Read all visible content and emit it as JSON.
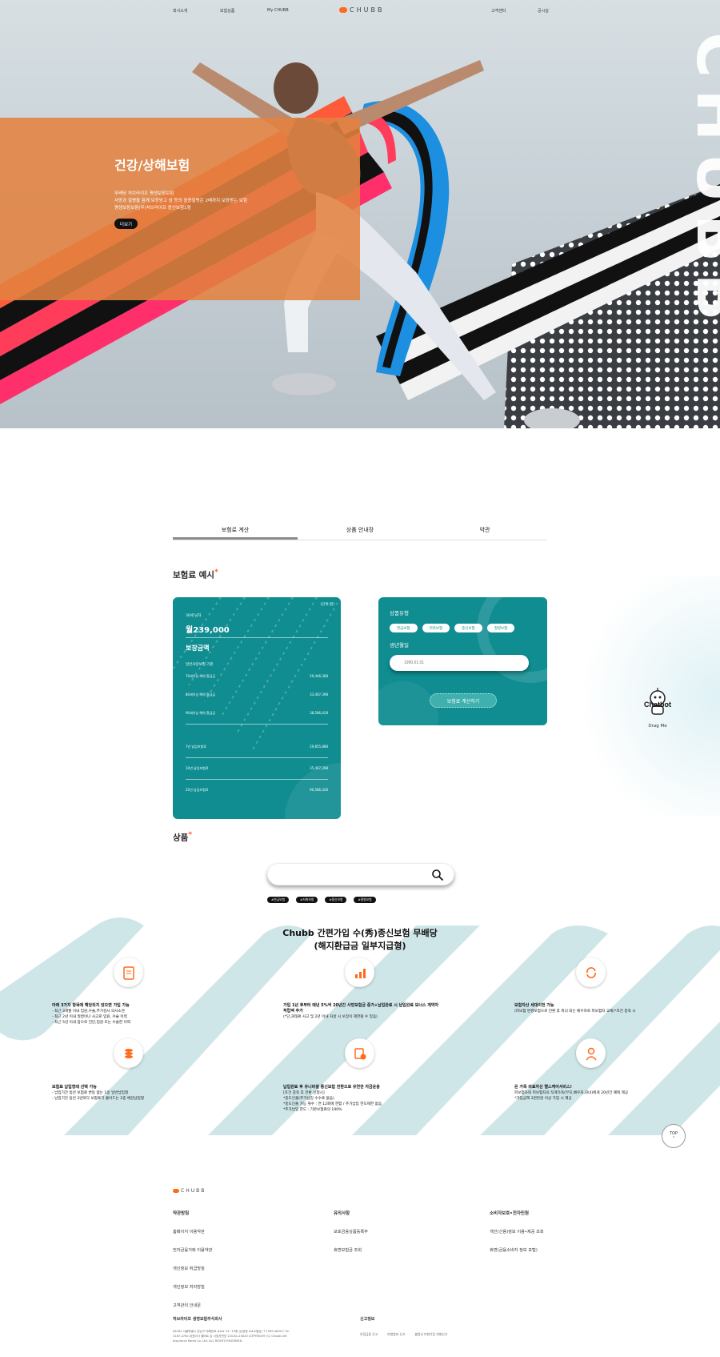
{
  "header": {
    "nav_left": [
      "회사소개",
      "보험상품",
      "My CHUBB"
    ],
    "logo_text": "CHUBB",
    "nav_right": [
      "고객센터",
      "공시실"
    ]
  },
  "hero": {
    "title": "건강/상해보험",
    "desc_lines": [
      "무배당 처브라이프 평생보장보험",
      "사망과 질병을 함께 보장받고 암 등의 중증질병은 2배까지 보장받는 보험",
      "평생보장보험(무)처브라이프 종신보험1형"
    ],
    "button": "더보기",
    "brand_vertical": "CHUBB"
  },
  "tabs": [
    "보험료 계산",
    "상품 안내장",
    "약관"
  ],
  "premium_section": {
    "title": "보험료 예시",
    "card": {
      "unit": "(단위:원)",
      "monthly_label": "30세 남자",
      "monthly_value": "월239,000",
      "coverage_title": "보장금액",
      "coverage_sub": "일반사망보험 기준",
      "rows_a": [
        {
          "label": "70세이상 해약 환급금",
          "value": "29,446,368"
        },
        {
          "label": "80세이상 해약 환급금",
          "value": "33,407,398"
        },
        {
          "label": "90세이상 해약 환급금",
          "value": "38,586,428"
        }
      ],
      "rows_b": [
        {
          "label": "7년 납입보험료",
          "value": "29,855,888"
        },
        {
          "label": "10년 납입보험료",
          "value": "35,407,398"
        },
        {
          "label": "20년 납입보험료",
          "value": "90,586,428"
        }
      ]
    },
    "form": {
      "product_type_label": "상품유형",
      "types": [
        "연금보험",
        "저축보험",
        "종신보험",
        "질병보험"
      ],
      "birth_label": "생년월일",
      "birth_placeholder": "1990.01.01",
      "submit": "보험료 계산하기"
    }
  },
  "chatbot": {
    "name": "Chatbot",
    "label": "Drag Me"
  },
  "products_section": {
    "title": "상품",
    "search_placeholder": "",
    "tags": [
      "#연금보험",
      "#저축보험",
      "#종신보험",
      "#질병보험"
    ]
  },
  "featured": {
    "title_line1": "Chubb 간편가입 수(秀)종신보험 무배당",
    "title_line2": "(해지환급금 일부지급형)",
    "items": [
      {
        "icon": "clipboard-icon",
        "title": "아래 3가지 항목에 해당되지 않으면 가입 가능",
        "lines": [
          "- 최근 3개월 이내 입원,수술,추가검사 의사소견",
          "- 최근 2년 이내 질병이나 사고로 입원, 수술 이력",
          "- 최근 5년 이내 암으로 진단,입원 또는 수술한 이력"
        ]
      },
      {
        "icon": "growth-chart-icon",
        "title": "가입 1년 후부터 매년 5%씩 20년간 사망보험금 증가+납입완료 시 납입완료 보너스 계약자 적립액 추가",
        "lines": [
          "(*단,과태료 사고 및 2년 이내 자살 시 보장이 제한될 수 있음)"
        ]
      },
      {
        "icon": "refresh-icon",
        "title": "보험자산 세대이전 가능",
        "lines": [
          "(피보험 변경보험으로 전환 후 피너 되는 배우자로 피보험자 교체)*조건 충족 시"
        ]
      },
      {
        "icon": "coins-icon",
        "title": "보험료 납입형태 선택 가능",
        "lines": [
          "- 납입기간 동안 보험료 변동 없는 1종 일반납입형",
          "- 납입기간 동안 3년마다 보험료가 줄어드는 2종 체감납입형"
        ]
      },
      {
        "icon": "money-convert-icon",
        "title": "납입완료 후 유니버셜 종신보험 전환으로 유연한 자금운용",
        "lines": [
          "[조건 충족 후 전환 신청시]",
          "*중도인출(추가납입 수수료 없음)",
          "*중도인출 가능 횟수 : 연 12회에 한함 / 추가납입 한도제한 없음",
          "*추가납입 한도 : 기본보험료의 100%"
        ]
      },
      {
        "icon": "caregiver-icon",
        "title": "온 가족 의료자산 헬스케어서비스!",
        "lines": [
          "피보험자와 피보험자의 직계가족(부모,배우자,자녀)에게 20년간 혜택 제공",
          "*가입금액 3천만원 이상 가입 시 제공"
        ]
      }
    ]
  },
  "top_button": "TOP",
  "footer": {
    "logo_text": "CHUBB",
    "col1": {
      "title": "약관방침",
      "links": [
        "홈페이지 이용약관",
        "전자금융거래 이용약관",
        "개인정보 취급방침",
        "개인정보 처리방침",
        "고객관리 안내문"
      ]
    },
    "col2": {
      "title": "유의사항",
      "links": [
        "보호금융상품등록부",
        "휴면보험금 조회"
      ]
    },
    "col3": {
      "title": "소비자보호•전자민원",
      "links": [
        "개인(신용)정보 이용•제공 조회",
        "휴면(금융소비자 정보 포털)"
      ]
    },
    "company": "처브라이프 생명보험주식회사",
    "address": "06162 서울특별시 강남구 테헤란로 ### 13~15층 (삼성동 ###빌딩) T 1599-4600 F 02-2187-4700 대표이사 앨버트 김 사업자번호 120-81-23020 COPYRIGHT (C) Chubb Life Insurance Korea Co. Ltd. ALL RIGHTS RESERVED.",
    "notice_title": "신고정보",
    "notice_items": [
      "부정금융 신고",
      "보험범죄 신고",
      "불법사 보험가입 처벌신고"
    ]
  }
}
